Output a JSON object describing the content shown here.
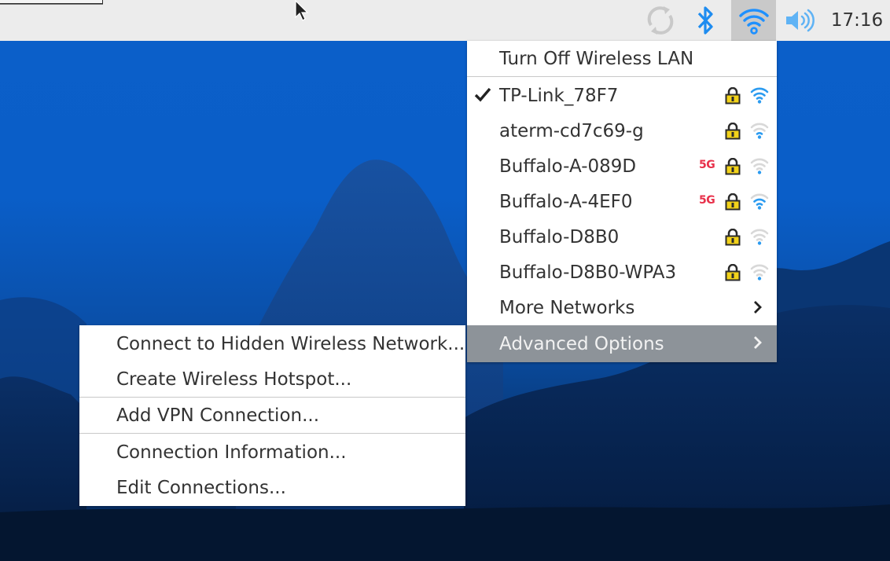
{
  "panel": {
    "clock": "17:16",
    "icons": [
      "sync-icon",
      "bluetooth-icon",
      "wifi-icon",
      "volume-icon"
    ],
    "accent": "#1e90ff"
  },
  "network_menu": {
    "toggle_label": "Turn Off Wireless LAN",
    "networks": [
      {
        "ssid": "TP-Link_78F7",
        "connected": true,
        "band": "",
        "secured": true,
        "signal": 1.0
      },
      {
        "ssid": "aterm-cd7c69-g",
        "connected": false,
        "band": "",
        "secured": true,
        "signal": 0.33
      },
      {
        "ssid": "Buffalo-A-089D",
        "connected": false,
        "band": "5G",
        "secured": true,
        "signal": 0.33
      },
      {
        "ssid": "Buffalo-A-4EF0",
        "connected": false,
        "band": "5G",
        "secured": true,
        "signal": 0.66
      },
      {
        "ssid": "Buffalo-D8B0",
        "connected": false,
        "band": "",
        "secured": true,
        "signal": 0.33
      },
      {
        "ssid": "Buffalo-D8B0-WPA3",
        "connected": false,
        "band": "",
        "secured": true,
        "signal": 0.33
      }
    ],
    "more_label": "More Networks",
    "advanced_label": "Advanced Options"
  },
  "advanced_menu": {
    "items": [
      "Connect to Hidden Wireless Network...",
      "Create Wireless Hotspot...",
      "Add VPN Connection...",
      "Connection Information...",
      "Edit Connections..."
    ]
  }
}
